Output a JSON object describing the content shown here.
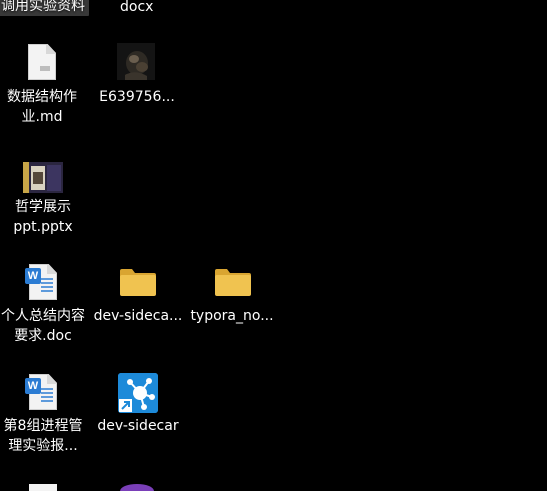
{
  "desktop": {
    "items": [
      {
        "label_lines": [
          "调用实验资料"
        ],
        "icon": "folder-icon"
      },
      {
        "label_lines": [
          "docx"
        ],
        "icon": "word-document-icon"
      },
      {
        "label_lines": [
          "数据结构作",
          "业.md"
        ],
        "icon": "markdown-file-icon"
      },
      {
        "label_lines": [
          "E639756..."
        ],
        "icon": "image-thumbnail-icon"
      },
      {
        "label_lines": [
          "哲学展示",
          "ppt.pptx"
        ],
        "icon": "powerpoint-thumbnail-icon"
      },
      {
        "label_lines": [
          "个人总结内容",
          "要求.doc"
        ],
        "icon": "word-document-icon"
      },
      {
        "label_lines": [
          "dev-sideca..."
        ],
        "icon": "folder-icon"
      },
      {
        "label_lines": [
          "typora_no..."
        ],
        "icon": "folder-icon"
      },
      {
        "label_lines": [
          "第8组进程管",
          "理实验报..."
        ],
        "icon": "word-document-icon"
      },
      {
        "label_lines": [
          "dev-sidecar"
        ],
        "icon": "dev-sidecar-app-icon"
      }
    ]
  },
  "colors": {
    "background": "#000000",
    "folder": "#f0c350",
    "word_blue": "#2b7cd3",
    "app_blue": "#1d8ad9"
  }
}
